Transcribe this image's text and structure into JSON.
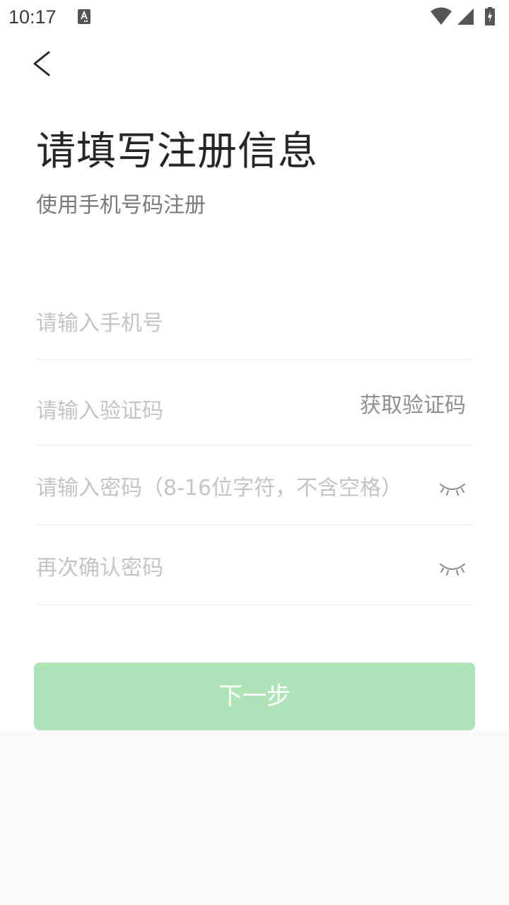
{
  "status_bar": {
    "time": "10:17",
    "icons": [
      "notification-a-icon",
      "wifi-icon",
      "cell-signal-icon",
      "battery-charging-icon"
    ]
  },
  "header": {
    "back_icon": "chevron-left-icon",
    "title": "请填写注册信息",
    "subtitle": "使用手机号码注册"
  },
  "form": {
    "phone_placeholder": "请输入手机号",
    "code_placeholder": "请输入验证码",
    "get_code_label": "获取验证码",
    "password_placeholder": "请输入密码（8-16位字符，不含空格）",
    "confirm_placeholder": "再次确认密码",
    "eye_icon": "eye-closed-icon"
  },
  "next_button_label": "下一步",
  "colors": {
    "button_bg": "#afe3b8",
    "button_text": "#ffffff",
    "placeholder": "#c4c4c4",
    "title": "#262626",
    "subtitle": "#7a7a7a"
  }
}
